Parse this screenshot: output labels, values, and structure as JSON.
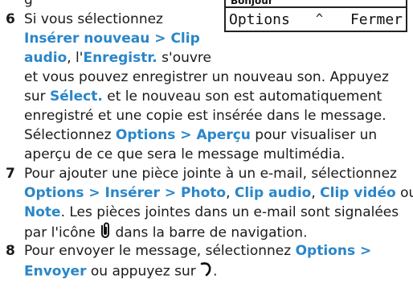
{
  "top_fragment": "g",
  "phone_screen": {
    "title": "Bonjour",
    "left_softkey": "Options",
    "middle_symbol": "^",
    "right_softkey": "Fermer"
  },
  "steps": [
    {
      "number": "6",
      "lines": [
        [
          {
            "t": "Si vous sélectionnez",
            "b": false
          }
        ],
        [
          {
            "t": "Insérer nouveau > Clip",
            "b": true
          }
        ],
        [
          {
            "t": "audio",
            "b": true
          },
          {
            "t": ", l'",
            "b": false
          },
          {
            "t": "Enregistr.",
            "b": true
          },
          {
            "t": " s'ouvre",
            "b": false
          }
        ],
        [
          {
            "t": "et vous pouvez enregistrer un nouveau son. Appuyez",
            "b": false
          }
        ],
        [
          {
            "t": "sur ",
            "b": false
          },
          {
            "t": "Sélect.",
            "b": true
          },
          {
            "t": " et le nouveau son est automatiquement",
            "b": false
          }
        ],
        [
          {
            "t": "enregistré et une copie est insérée dans le message.",
            "b": false
          }
        ],
        [
          {
            "t": "Sélectionnez ",
            "b": false
          },
          {
            "t": "Options > Aperçu",
            "b": true
          },
          {
            "t": " pour visualiser un",
            "b": false
          }
        ],
        [
          {
            "t": "aperçu de ce que sera le message multimédia.",
            "b": false
          }
        ]
      ]
    },
    {
      "number": "7",
      "lines": [
        [
          {
            "t": "Pour ajouter une pièce jointe à un e-mail, sélectionnez",
            "b": false
          }
        ],
        [
          {
            "t": "Options > Insérer > Photo",
            "b": true
          },
          {
            "t": ", ",
            "b": false
          },
          {
            "t": "Clip audio",
            "b": true
          },
          {
            "t": ", ",
            "b": false
          },
          {
            "t": "Clip vidéo",
            "b": true
          },
          {
            "t": " ou",
            "b": false
          }
        ],
        [
          {
            "t": "Note",
            "b": true
          },
          {
            "t": ". Les pièces jointes dans un e-mail sont signalées",
            "b": false
          }
        ],
        [
          {
            "t": "par l'icône ",
            "b": false
          },
          {
            "icon": "paperclip-icon"
          },
          {
            "t": " dans la barre de navigation.",
            "b": false
          }
        ]
      ]
    },
    {
      "number": "8",
      "lines": [
        [
          {
            "t": "Pour envoyer le message, sélectionnez ",
            "b": false
          },
          {
            "t": "Options >",
            "b": true
          }
        ],
        [
          {
            "t": "Envoyer",
            "b": true
          },
          {
            "t": " ou appuyez sur ",
            "b": false
          },
          {
            "icon": "call-key-icon"
          },
          {
            "t": ".",
            "b": false
          }
        ]
      ]
    }
  ],
  "colors": {
    "highlight": "#2a86c9",
    "text": "#1a1a1a"
  }
}
